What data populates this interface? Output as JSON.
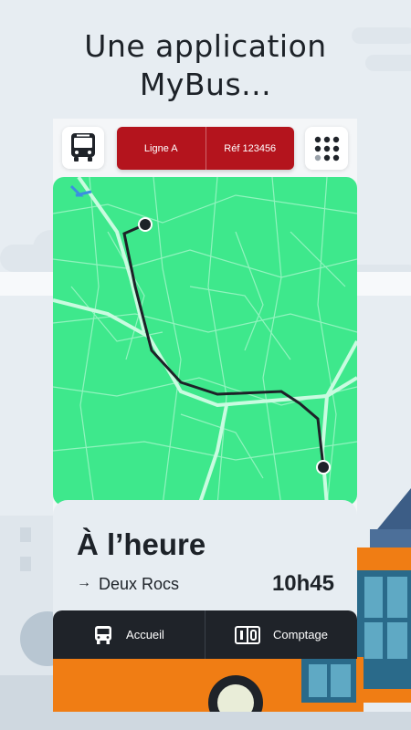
{
  "headline": {
    "line1": "Une application",
    "line2": "MyBus..."
  },
  "top_bar": {
    "logo_icon": "bus-icon",
    "line_label": "Ligne A",
    "ref_label": "Réf 123456",
    "menu_icon": "grid-dots-icon"
  },
  "map": {
    "accent": "#3ee88c",
    "route_color": "#1d2228"
  },
  "status": {
    "title": "À l’heure",
    "arrow": "→",
    "stop": "Deux Rocs",
    "time": "10h45"
  },
  "nav": {
    "home_label": "Accueil",
    "home_icon": "bus-icon",
    "count_label": "Comptage",
    "count_icon": "counter-icon"
  },
  "colors": {
    "brand_red": "#b4141d",
    "dark": "#1f2329",
    "background": "#e7edf2"
  }
}
